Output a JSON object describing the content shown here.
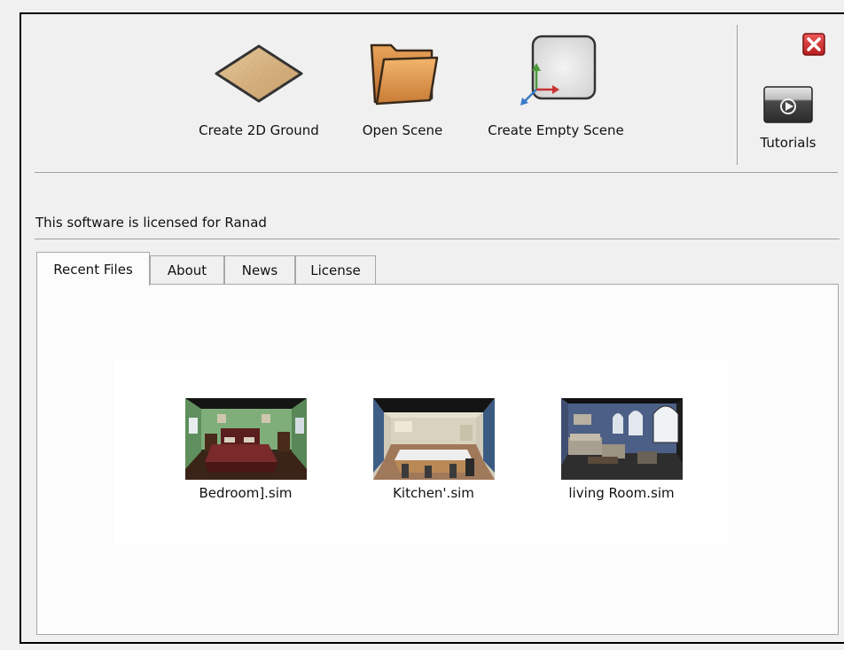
{
  "toolbar": {
    "create_2d_ground": "Create 2D Ground",
    "open_scene": "Open Scene",
    "create_empty_scene": "Create Empty Scene",
    "tutorials": "Tutorials"
  },
  "license_text": "This software is licensed for Ranad",
  "tabs": [
    {
      "label": "Recent Files",
      "active": true
    },
    {
      "label": "About",
      "active": false
    },
    {
      "label": "News",
      "active": false
    },
    {
      "label": "License",
      "active": false
    }
  ],
  "recent_files": [
    {
      "name": "Bedroom].sim",
      "thumbnail": "bedroom-scene"
    },
    {
      "name": "Kitchen'.sim",
      "thumbnail": "kitchen-scene"
    },
    {
      "name": "living Room.sim",
      "thumbnail": "living-room-scene"
    }
  ],
  "colors": {
    "close_red": "#d42a2a",
    "folder_orange": "#d2883a",
    "ground_tan": "#d9b98a"
  }
}
